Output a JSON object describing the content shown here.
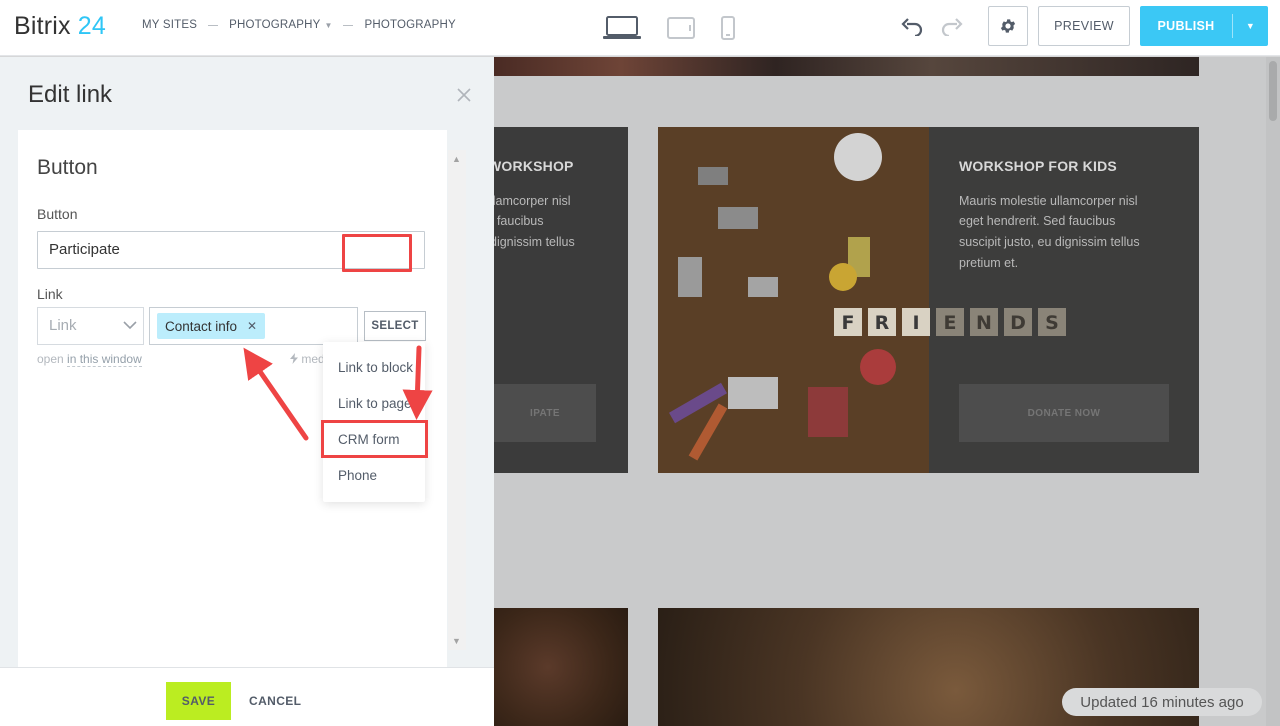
{
  "topbar": {
    "logo_text": "Bitrix",
    "logo_num": "24",
    "breadcrumbs": [
      "MY SITES",
      "PHOTOGRAPHY",
      "PHOTOGRAPHY"
    ],
    "preview_label": "PREVIEW",
    "publish_label": "PUBLISH",
    "icons": [
      "desktop-icon",
      "tablet-icon",
      "mobile-icon",
      "undo-icon",
      "redo-icon",
      "gear-icon"
    ]
  },
  "background_page": {
    "cards": [
      {
        "title": "WORKSHOP",
        "text": [
          "llamcorper nisl",
          "t faucibus",
          "dignissim tellus"
        ],
        "button": "IPATE"
      },
      {
        "title": "WORKSHOP FOR KIDS",
        "text": [
          "Mauris molestie ullamcorper nisl",
          "eget hendrerit. Sed faucibus",
          "suscipit justo, eu dignissim tellus",
          "pretium et."
        ],
        "button": "DONATE NOW"
      }
    ],
    "photo_letters": [
      "F",
      "R",
      "I",
      "E",
      "N",
      "D",
      "S"
    ],
    "status": "Updated 16 minutes ago"
  },
  "panel": {
    "title": "Edit link",
    "card_title": "Button",
    "button_field_label": "Button",
    "button_field_value": "Participate",
    "link_field_label": "Link",
    "link_type_value": "Link",
    "tag_label": "Contact info",
    "select_label": "SELECT",
    "open_in_prefix": "open",
    "open_in_target": "in this window",
    "media_label": "med",
    "menu_items": [
      "Link to block",
      "Link to page",
      "CRM form",
      "Phone"
    ],
    "save_label": "SAVE",
    "cancel_label": "CANCEL"
  },
  "colors": {
    "accent": "#2fc6f6",
    "publish": "#3bc8f5",
    "save": "#bbed21",
    "highlight": "#ee4444",
    "tag": "#bcedfc"
  }
}
